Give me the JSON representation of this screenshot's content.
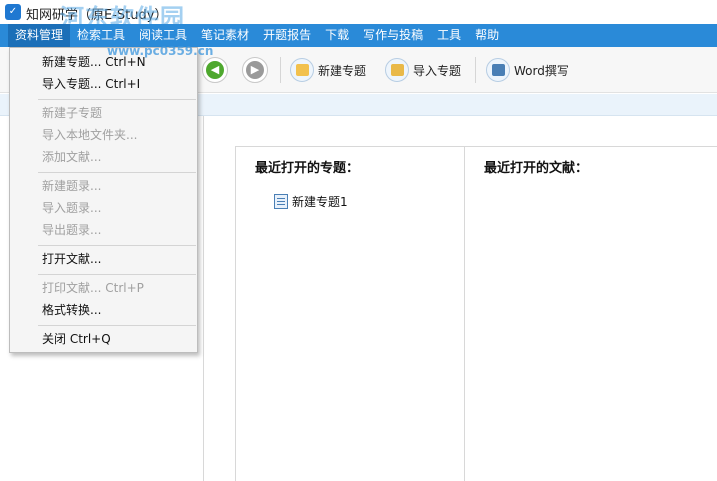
{
  "window": {
    "title": "知网研学（原E-Study）",
    "watermark": "河东软件园",
    "watermark_url": "www.pc0359.cn"
  },
  "menubar": {
    "items": [
      "资料管理",
      "检索工具",
      "阅读工具",
      "笔记素材",
      "开题报告",
      "下载",
      "写作与投稿",
      "工具",
      "帮助"
    ],
    "active_index": 0
  },
  "toolbar": {
    "back_icon": "arrow-left-icon",
    "forward_icon": "arrow-right-icon",
    "new_topic_label": "新建专题",
    "import_topic_label": "导入专题",
    "word_write_label": "Word撰写"
  },
  "dropdown": {
    "items": [
      {
        "label": "新建专题... Ctrl+N",
        "enabled": true
      },
      {
        "label": "导入专题... Ctrl+I",
        "enabled": true
      },
      {
        "label": "新建子专题",
        "enabled": false
      },
      {
        "label": "导入本地文件夹...",
        "enabled": false
      },
      {
        "label": "添加文献...",
        "enabled": false
      },
      {
        "label": "新建题录...",
        "enabled": false
      },
      {
        "label": "导入题录...",
        "enabled": false
      },
      {
        "label": "导出题录...",
        "enabled": false
      },
      {
        "label": "打开文献...",
        "enabled": true
      },
      {
        "label": "打印文献... Ctrl+P",
        "enabled": false
      },
      {
        "label": "格式转换...",
        "enabled": true
      },
      {
        "label": "关闭 Ctrl+Q",
        "enabled": true
      }
    ]
  },
  "recent_topics": {
    "title": "最近打开的专题：",
    "items": [
      "新建专题1"
    ]
  },
  "recent_docs": {
    "title": "最近打开的文献："
  },
  "colors": {
    "menubar": "#2a8ad8",
    "menu_active": "#1b6fb8",
    "back_button": "#4ea82e"
  }
}
